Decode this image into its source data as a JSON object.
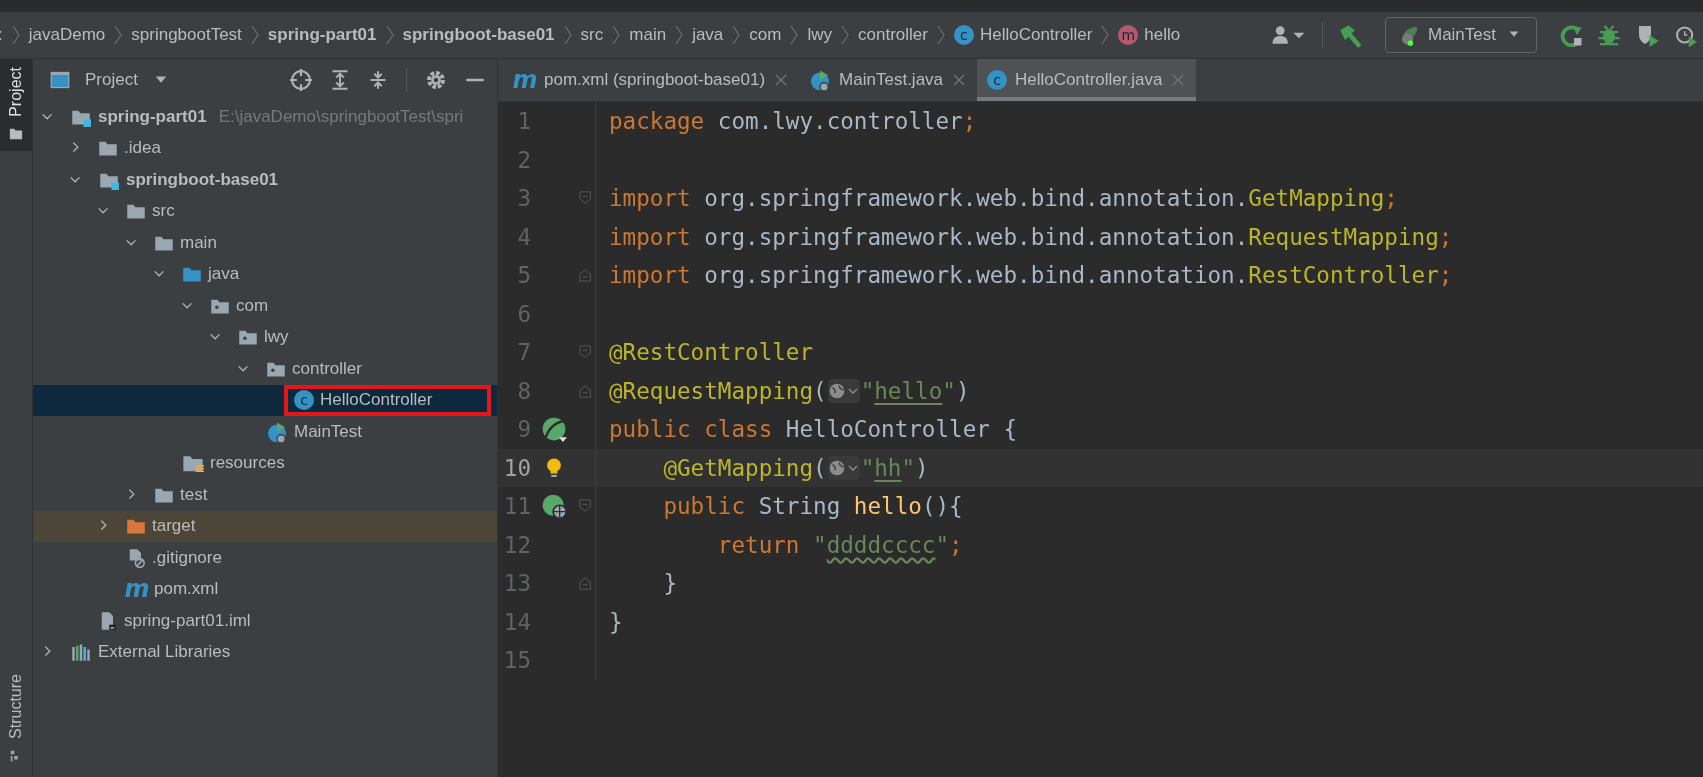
{
  "breadcrumbs": [
    {
      "label": ":",
      "kind": "drive"
    },
    {
      "label": "javaDemo",
      "kind": "folder"
    },
    {
      "label": "springbootTest",
      "kind": "folder"
    },
    {
      "label": "spring-part01",
      "kind": "module"
    },
    {
      "label": "springboot-base01",
      "kind": "module"
    },
    {
      "label": "src",
      "kind": "folder"
    },
    {
      "label": "main",
      "kind": "folder"
    },
    {
      "label": "java",
      "kind": "folder"
    },
    {
      "label": "com",
      "kind": "folder"
    },
    {
      "label": "lwy",
      "kind": "folder"
    },
    {
      "label": "controller",
      "kind": "folder"
    },
    {
      "label": "HelloController",
      "kind": "class",
      "glyph": "c"
    },
    {
      "label": "hello",
      "kind": "method",
      "glyph": "m"
    }
  ],
  "toolbar": {
    "run_config": "MainTest"
  },
  "tool_strip": [
    {
      "label": "Project",
      "selected": true
    },
    {
      "label": "Structure",
      "selected": false
    }
  ],
  "project_panel": {
    "title": "Project",
    "tree": [
      {
        "label": "spring-part01",
        "hint": "E:\\javaDemo\\springbootTest\\spri",
        "kind": "module",
        "expanded": true,
        "selected": false,
        "children": [
          {
            "label": ".idea",
            "kind": "folder",
            "expanded": false,
            "selected": false
          },
          {
            "label": "springboot-base01",
            "kind": "module",
            "expanded": true,
            "selected": false,
            "children": [
              {
                "label": "src",
                "kind": "folder",
                "expanded": true,
                "selected": false,
                "children": [
                  {
                    "label": "main",
                    "kind": "folder",
                    "expanded": true,
                    "selected": false,
                    "children": [
                      {
                        "label": "java",
                        "kind": "source-root",
                        "expanded": true,
                        "selected": false,
                        "children": [
                          {
                            "label": "com",
                            "kind": "package",
                            "expanded": true,
                            "selected": false,
                            "children": [
                              {
                                "label": "lwy",
                                "kind": "package",
                                "expanded": true,
                                "selected": false,
                                "children": [
                                  {
                                    "label": "controller",
                                    "kind": "package",
                                    "expanded": true,
                                    "selected": false,
                                    "children": [
                                      {
                                        "label": "HelloController",
                                        "kind": "class",
                                        "glyph": "c",
                                        "selected": true,
                                        "highlighted": true
                                      }
                                    ]
                                  },
                                  {
                                    "label": "MainTest",
                                    "kind": "run-class",
                                    "selected": false,
                                    "highlighted": false
                                  }
                                ]
                              }
                            ]
                          }
                        ]
                      },
                      {
                        "label": "resources",
                        "kind": "resources",
                        "selected": false
                      }
                    ]
                  },
                  {
                    "label": "test",
                    "kind": "folder",
                    "expanded": false,
                    "selected": false
                  }
                ]
              },
              {
                "label": "target",
                "kind": "excluded-folder",
                "expanded": false,
                "selected": false
              },
              {
                "label": ".gitignore",
                "kind": "ignore-file",
                "selected": false
              },
              {
                "label": "pom.xml",
                "kind": "maven",
                "glyph": "m",
                "selected": false
              }
            ]
          },
          {
            "label": "spring-part01.iml",
            "kind": "iml-file",
            "selected": false
          }
        ]
      },
      {
        "label": "External Libraries",
        "kind": "libraries",
        "expanded": false,
        "selected": false
      }
    ]
  },
  "editor_tabs": [
    {
      "label": "pom.xml (springboot-base01)",
      "kind": "maven",
      "glyph": "m",
      "selected": false
    },
    {
      "label": "MainTest.java",
      "kind": "run-class",
      "selected": false
    },
    {
      "label": "HelloController.java",
      "kind": "class",
      "glyph": "c",
      "selected": true
    }
  ],
  "code_lines": [
    {
      "number": "1",
      "current": false,
      "tokens": [
        {
          "text": "package ",
          "kind": "kw"
        },
        {
          "text": "com.lwy.controller",
          "kind": "plain"
        },
        {
          "text": ";",
          "kind": "kw"
        }
      ]
    },
    {
      "number": "2",
      "current": false
    },
    {
      "number": "3",
      "current": false,
      "fold": {
        "kind": "start"
      },
      "tokens": [
        {
          "text": "import ",
          "kind": "kw"
        },
        {
          "text": "org.springframework.web.bind.annotation.",
          "kind": "plain"
        },
        {
          "text": "GetMapping",
          "kind": "ann"
        },
        {
          "text": ";",
          "kind": "kw"
        }
      ]
    },
    {
      "number": "4",
      "current": false,
      "tokens": [
        {
          "text": "import ",
          "kind": "kw"
        },
        {
          "text": "org.springframework.web.bind.annotation.",
          "kind": "plain"
        },
        {
          "text": "RequestMapping",
          "kind": "ann"
        },
        {
          "text": ";",
          "kind": "kw"
        }
      ]
    },
    {
      "number": "5",
      "current": false,
      "fold": {
        "kind": "end"
      },
      "tokens": [
        {
          "text": "import ",
          "kind": "kw"
        },
        {
          "text": "org.springframework.web.bind.annotation.",
          "kind": "plain"
        },
        {
          "text": "RestController",
          "kind": "ann"
        },
        {
          "text": ";",
          "kind": "kw"
        }
      ]
    },
    {
      "number": "6",
      "current": false
    },
    {
      "number": "7",
      "current": false,
      "fold": {
        "kind": "start"
      },
      "tokens": [
        {
          "text": "@RestController",
          "kind": "ann"
        }
      ]
    },
    {
      "number": "8",
      "current": false,
      "fold": {
        "kind": "end"
      },
      "tokens": [
        {
          "text": "@RequestMapping",
          "kind": "ann"
        },
        {
          "text": "(",
          "kind": "plain"
        },
        {
          "kind": "globe"
        },
        {
          "text": "\"",
          "kind": "str"
        },
        {
          "text": "hello",
          "kind": "url"
        },
        {
          "text": "\"",
          "kind": "str"
        },
        {
          "text": ")",
          "kind": "plain"
        }
      ]
    },
    {
      "number": "9",
      "current": false,
      "gutter": {
        "kind": "bean"
      },
      "tokens": [
        {
          "text": "public class ",
          "kind": "kw"
        },
        {
          "text": "HelloController {",
          "kind": "plain"
        }
      ]
    },
    {
      "number": "10",
      "current": true,
      "gutter": {
        "kind": "bulb"
      },
      "tokens": [
        {
          "text": "    @GetMapping",
          "kind": "ann"
        },
        {
          "text": "(",
          "kind": "plain"
        },
        {
          "kind": "globe"
        },
        {
          "text": "\"",
          "kind": "str"
        },
        {
          "text": "hh",
          "kind": "url"
        },
        {
          "text": "\"",
          "kind": "str"
        },
        {
          "text": ")",
          "kind": "plain"
        }
      ]
    },
    {
      "number": "11",
      "current": false,
      "gutter": {
        "kind": "web"
      },
      "fold": {
        "kind": "start"
      },
      "tokens": [
        {
          "text": "    public ",
          "kind": "kw"
        },
        {
          "text": "String ",
          "kind": "plain"
        },
        {
          "text": "hello",
          "kind": "method"
        },
        {
          "text": "(){",
          "kind": "plain"
        }
      ]
    },
    {
      "number": "12",
      "current": false,
      "tokens": [
        {
          "text": "        return ",
          "kind": "kw"
        },
        {
          "text": "\"",
          "kind": "str"
        },
        {
          "text": "ddddcccc",
          "kind": "typo"
        },
        {
          "text": "\"",
          "kind": "str"
        },
        {
          "text": ";",
          "kind": "kw"
        }
      ]
    },
    {
      "number": "13",
      "current": false,
      "fold": {
        "kind": "end"
      },
      "tokens": [
        {
          "text": "    }",
          "kind": "plain"
        }
      ]
    },
    {
      "number": "14",
      "current": false,
      "tokens": [
        {
          "text": "}",
          "kind": "plain"
        }
      ]
    },
    {
      "number": "15",
      "current": false
    }
  ]
}
